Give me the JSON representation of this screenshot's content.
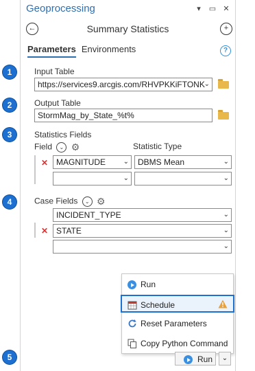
{
  "pane": {
    "title": "Geoprocessing",
    "titlebar_icons": [
      "dropdown-icon",
      "pin-icon",
      "close-icon"
    ],
    "tool_title": "Summary Statistics",
    "tabs": [
      {
        "label": "Parameters",
        "active": true
      },
      {
        "label": "Environments",
        "active": false
      }
    ]
  },
  "callouts": [
    "1",
    "2",
    "3",
    "4",
    "5"
  ],
  "input_table": {
    "label": "Input Table",
    "value": "https://services9.arcgis.com/RHVPKKiFTONK"
  },
  "output_table": {
    "label": "Output Table",
    "value": "StormMag_by_State_%t%"
  },
  "statistics": {
    "label": "Statistics Fields",
    "field_header": "Field",
    "type_header": "Statistic Type",
    "rows": [
      {
        "field": "MAGNITUDE",
        "type": "DBMS Mean"
      },
      {
        "field": "",
        "type": ""
      }
    ]
  },
  "case_fields": {
    "label": "Case Fields",
    "rows": [
      "INCIDENT_TYPE",
      "STATE",
      ""
    ]
  },
  "menu": {
    "items": [
      {
        "label": "Run",
        "icon": "run-icon"
      },
      {
        "label": "Schedule",
        "icon": "calendar-icon",
        "warning": true
      },
      {
        "label": "Reset Parameters",
        "icon": "reset-icon"
      },
      {
        "label": "Copy Python Command",
        "icon": "copy-icon"
      }
    ]
  },
  "run_button": {
    "label": "Run"
  },
  "colors": {
    "accent": "#2f6fb0",
    "callout": "#1d6fd0",
    "warning": "#e8a13a",
    "remove": "#dd3333"
  }
}
